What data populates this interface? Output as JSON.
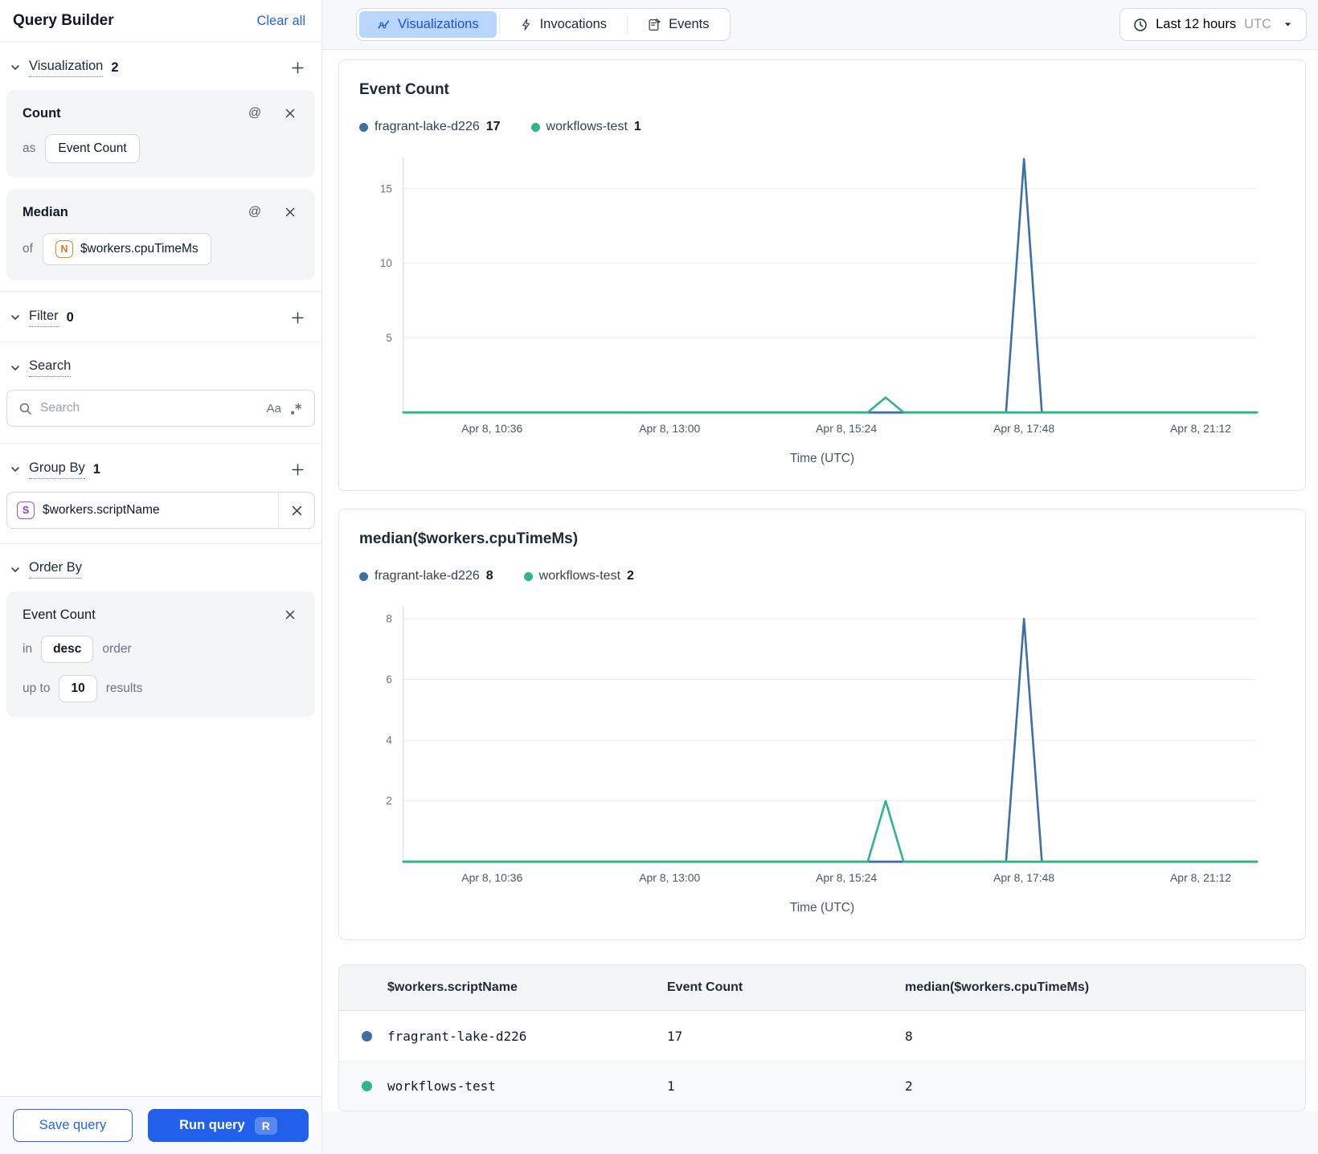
{
  "sidebar": {
    "title": "Query Builder",
    "clear_all_label": "Clear all",
    "sections": {
      "visualization": {
        "label": "Visualization",
        "count": "2"
      },
      "filter": {
        "label": "Filter",
        "count": "0"
      },
      "search": {
        "label": "Search"
      },
      "group_by": {
        "label": "Group By",
        "count": "1"
      },
      "order_by": {
        "label": "Order By"
      }
    },
    "count_card": {
      "title": "Count",
      "as_label": "as",
      "value": "Event Count"
    },
    "median_card": {
      "title": "Median",
      "of_label": "of",
      "badge": "N",
      "value": "$workers.cpuTimeMs"
    },
    "search_input": {
      "placeholder": "Search",
      "match_case_label": "Aa"
    },
    "group_by_item": {
      "badge": "S",
      "value": "$workers.scriptName"
    },
    "order_by_card": {
      "field": "Event Count",
      "in_label": "in",
      "direction": "desc",
      "order_label": "order",
      "up_to_label": "up to",
      "limit": "10",
      "results_label": "results"
    },
    "footer": {
      "save_label": "Save query",
      "run_label": "Run query",
      "run_shortcut": "R"
    }
  },
  "header": {
    "tabs": [
      {
        "label": "Visualizations",
        "icon": "line-chart-icon",
        "active": true
      },
      {
        "label": "Invocations",
        "icon": "lightning-icon",
        "active": false
      },
      {
        "label": "Events",
        "icon": "form-icon",
        "active": false
      }
    ],
    "time_range": {
      "label": "Last 12 hours",
      "timezone": "UTC"
    }
  },
  "chart_data": [
    {
      "type": "line",
      "title": "Event Count",
      "xlabel": "Time (UTC)",
      "x_ticks": [
        "Apr 8, 10:36",
        "Apr 8, 13:00",
        "Apr 8, 15:24",
        "Apr 8, 17:48",
        "Apr 8, 21:12"
      ],
      "x_tick_fracs": [
        0.104,
        0.312,
        0.519,
        0.727,
        0.934
      ],
      "y_ticks": [
        5,
        10,
        15
      ],
      "ylim": [
        0,
        17.1
      ],
      "grid": true,
      "legend_position": "top",
      "legend": [
        {
          "name": "fragrant-lake-d226",
          "value": "17",
          "color": "#3d6fa6"
        },
        {
          "name": "workflows-test",
          "value": "1",
          "color": "#30b584"
        }
      ],
      "series": [
        {
          "name": "fragrant-lake-d226",
          "color": "#3d6fa6",
          "points": [
            [
              0,
              0
            ],
            [
              0.706,
              0
            ],
            [
              0.727,
              17
            ],
            [
              0.748,
              0
            ],
            [
              1,
              0
            ]
          ]
        },
        {
          "name": "workflows-test",
          "color": "#30b584",
          "points": [
            [
              0,
              0
            ],
            [
              0.544,
              0
            ],
            [
              0.565,
              1
            ],
            [
              0.586,
              0
            ],
            [
              1,
              0
            ]
          ]
        }
      ]
    },
    {
      "type": "line",
      "title": "median($workers.cpuTimeMs)",
      "xlabel": "Time (UTC)",
      "x_ticks": [
        "Apr 8, 10:36",
        "Apr 8, 13:00",
        "Apr 8, 15:24",
        "Apr 8, 17:48",
        "Apr 8, 21:12"
      ],
      "x_tick_fracs": [
        0.104,
        0.312,
        0.519,
        0.727,
        0.934
      ],
      "y_ticks": [
        2,
        4,
        6,
        8
      ],
      "ylim": [
        0,
        8.4
      ],
      "grid": true,
      "legend_position": "top",
      "legend": [
        {
          "name": "fragrant-lake-d226",
          "value": "8",
          "color": "#3d6fa6"
        },
        {
          "name": "workflows-test",
          "value": "2",
          "color": "#30b584"
        }
      ],
      "series": [
        {
          "name": "fragrant-lake-d226",
          "color": "#3d6fa6",
          "points": [
            [
              0,
              0
            ],
            [
              0.706,
              0
            ],
            [
              0.727,
              8
            ],
            [
              0.748,
              0
            ],
            [
              1,
              0
            ]
          ]
        },
        {
          "name": "workflows-test",
          "color": "#30b584",
          "points": [
            [
              0,
              0
            ],
            [
              0.544,
              0
            ],
            [
              0.565,
              2
            ],
            [
              0.586,
              0
            ],
            [
              1,
              0
            ]
          ]
        }
      ]
    }
  ],
  "table": {
    "columns": [
      "$workers.scriptName",
      "Event Count",
      "median($workers.cpuTimeMs)"
    ],
    "rows": [
      {
        "color": "#3d6fa6",
        "cells": [
          "fragrant-lake-d226",
          "17",
          "8"
        ]
      },
      {
        "color": "#30b584",
        "cells": [
          "workflows-test",
          "1",
          "2"
        ]
      }
    ]
  },
  "colors": {
    "accent_blue": "#2563eb",
    "series_blue": "#3d6fa6",
    "series_green": "#30b584",
    "tab_active_bg": "#b9d7fe",
    "tab_active_text": "#1b4fd8"
  }
}
